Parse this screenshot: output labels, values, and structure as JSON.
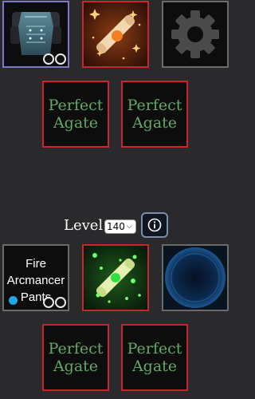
{
  "top_row": {
    "armor": {
      "icon": "armor-chest-icon",
      "sockets": 2
    },
    "scroll": {
      "icon": "orange-scroll-icon",
      "accent": "#f08020"
    },
    "settings": {
      "icon": "gear-icon"
    }
  },
  "top_gems": [
    {
      "label": "Perfect Agate"
    },
    {
      "label": "Perfect Agate"
    }
  ],
  "level": {
    "label": "Level",
    "selected": "140",
    "info_icon": "info-icon"
  },
  "bottom_row": {
    "pants": {
      "name": "Fire Arcmancer Pants",
      "sockets": 2,
      "dot_color": "#20a8e8"
    },
    "scroll": {
      "icon": "green-scroll-icon",
      "accent": "#30e040"
    },
    "portal": {
      "icon": "blue-portal-icon"
    }
  },
  "bottom_gems": [
    {
      "label": "Perfect Agate"
    },
    {
      "label": "Perfect Agate"
    }
  ],
  "colors": {
    "background": "#2a2a2c",
    "gem_text": "#62a865",
    "red_border": "#c8262a",
    "purple_border": "#7d78c8"
  }
}
